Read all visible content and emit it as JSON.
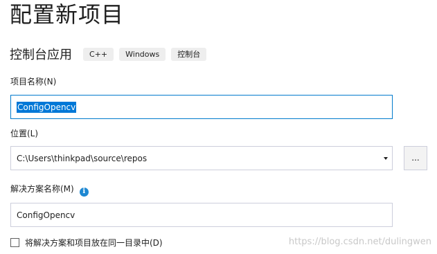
{
  "header": {
    "title": "配置新项目",
    "template_name": "控制台应用",
    "tags": [
      "C++",
      "Windows",
      "控制台"
    ]
  },
  "project_name": {
    "label": "项目名称(N)",
    "value": "ConfigOpencv"
  },
  "location": {
    "label": "位置(L)",
    "value": "C:\\Users\\thinkpad\\source\\repos",
    "browse_label": "..."
  },
  "solution_name": {
    "label": "解决方案名称(M)",
    "value": "ConfigOpencv"
  },
  "same_directory": {
    "label": "将解决方案和项目放在同一目录中(D)",
    "checked": false
  },
  "watermark": "https://blog.csdn.net/dulingwen",
  "icons": {
    "info": "info-icon",
    "dropdown": "chevron-down-icon"
  },
  "colors": {
    "focus_border": "#007acc",
    "selection": "#0078d7",
    "info": "#1e88d2"
  }
}
